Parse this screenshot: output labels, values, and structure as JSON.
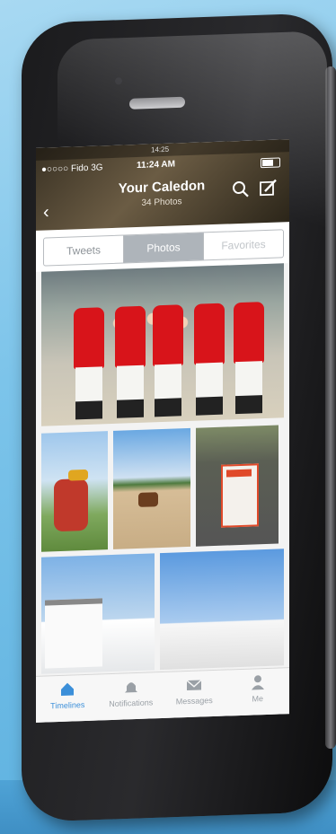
{
  "os_status": {
    "time": "14:25"
  },
  "status_bar": {
    "carrier": "●○○○○ Fido  3G",
    "time": "11:24 AM"
  },
  "header": {
    "title": "Your Caledon",
    "subtitle": "34 Photos",
    "back_icon": "chevron-left-icon",
    "search_icon": "search-icon",
    "compose_icon": "compose-icon"
  },
  "segments": [
    {
      "label": "Tweets",
      "active": false
    },
    {
      "label": "Photos",
      "active": true
    },
    {
      "label": "Favorites",
      "active": false
    }
  ],
  "tabs": [
    {
      "label": "Timelines",
      "icon": "home-icon",
      "active": true
    },
    {
      "label": "Notifications",
      "icon": "bell-icon",
      "active": false
    },
    {
      "label": "Messages",
      "icon": "envelope-icon",
      "active": false
    },
    {
      "label": "Me",
      "icon": "person-icon",
      "active": false
    }
  ],
  "colors": {
    "accent": "#3b8fd9",
    "header_bg": "#4a4030"
  }
}
